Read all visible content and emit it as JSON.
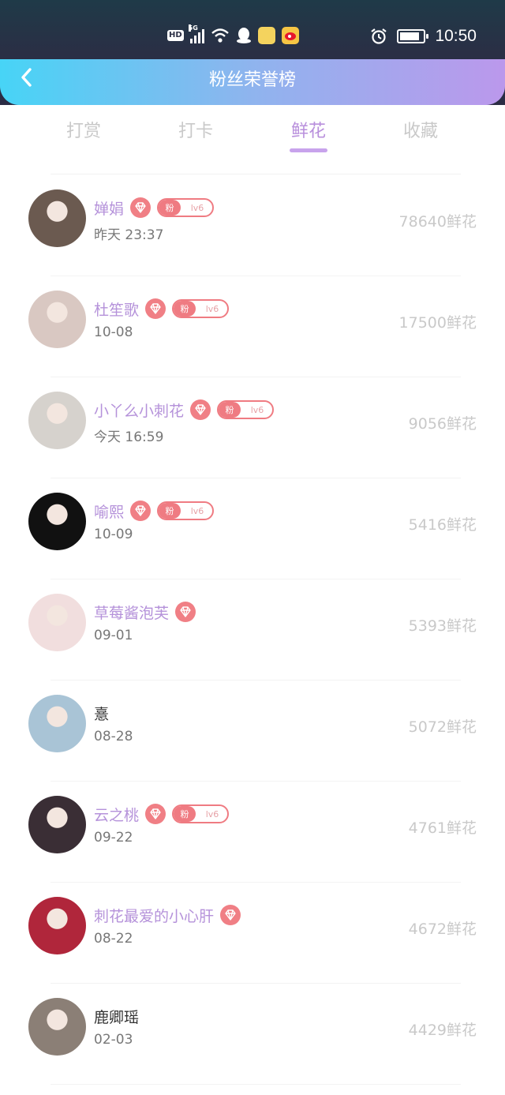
{
  "status_bar": {
    "hd_badge": "HD",
    "network": "5G",
    "time": "10:50"
  },
  "header": {
    "title": "粉丝荣誉榜"
  },
  "tabs": [
    {
      "label": "打赏",
      "active": false
    },
    {
      "label": "打卡",
      "active": false
    },
    {
      "label": "鲜花",
      "active": true
    },
    {
      "label": "收藏",
      "active": false
    }
  ],
  "badge": {
    "fan_label": "粉",
    "level_label": "lv6"
  },
  "colors": {
    "accent_purple": "#b592da",
    "badge_red": "#ef7b82",
    "header_gradient_start": "#47d4f6",
    "header_gradient_end": "#bb98ec"
  },
  "fans": [
    {
      "name": "婵娟",
      "time": "昨天 23:37",
      "amount": "78640鲜花",
      "vip": true,
      "fan_badge": true,
      "avatar_color": "#6b5a50"
    },
    {
      "name": "杜笙歌",
      "time": "10-08",
      "amount": "17500鲜花",
      "vip": true,
      "fan_badge": true,
      "avatar_color": "#d9c8c2"
    },
    {
      "name": "小丫么小刺花",
      "time": "今天 16:59",
      "amount": "9056鲜花",
      "vip": true,
      "fan_badge": true,
      "avatar_color": "#d6d2cd"
    },
    {
      "name": "喻熙",
      "time": "10-09",
      "amount": "5416鲜花",
      "vip": true,
      "fan_badge": true,
      "avatar_color": "#111111"
    },
    {
      "name": "草莓酱泡芙",
      "time": "09-01",
      "amount": "5393鲜花",
      "vip": true,
      "fan_badge": false,
      "avatar_color": "#f1dede"
    },
    {
      "name": "憙",
      "time": "08-28",
      "amount": "5072鲜花",
      "vip": false,
      "fan_badge": false,
      "avatar_color": "#a9c4d6"
    },
    {
      "name": "云之桃",
      "time": "09-22",
      "amount": "4761鲜花",
      "vip": true,
      "fan_badge": true,
      "avatar_color": "#3a2e35"
    },
    {
      "name": "刺花最爱的小心肝",
      "time": "08-22",
      "amount": "4672鲜花",
      "vip": true,
      "fan_badge": false,
      "avatar_color": "#b0263b"
    },
    {
      "name": "鹿卿瑶",
      "time": "02-03",
      "amount": "4429鲜花",
      "vip": false,
      "fan_badge": false,
      "avatar_color": "#8b7f76"
    }
  ]
}
